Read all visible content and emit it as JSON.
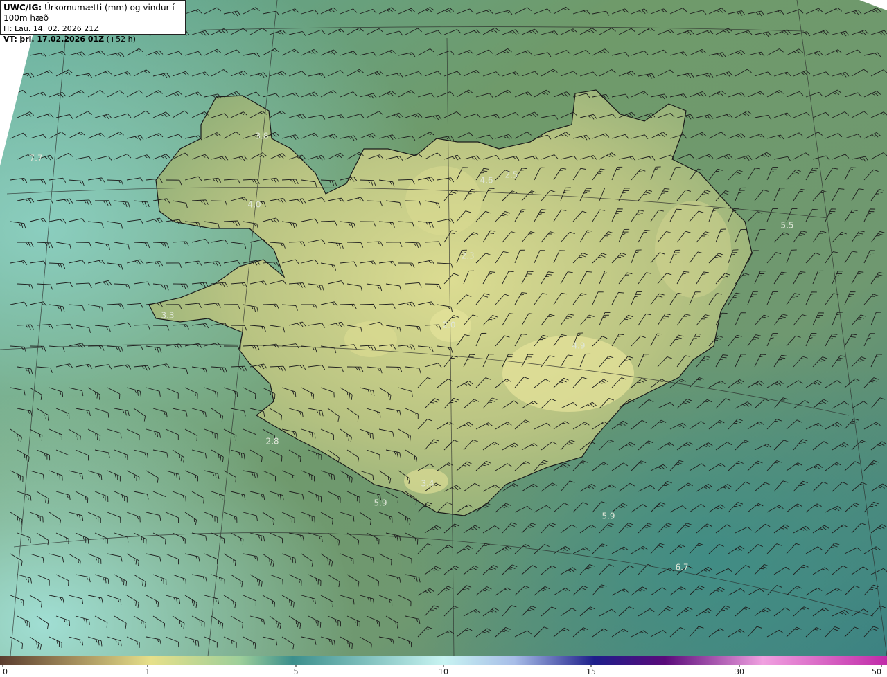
{
  "header": {
    "model": "UWC/IG:",
    "title": "Úrkomumætti (mm) og vindur í 100m hæð",
    "it_label": "IT:",
    "it_value": "Lau. 14. 02. 2026 21Z",
    "vt_label": "VT:",
    "vt_value": "þri. 17.02.2026 01Z",
    "vt_lead": "(+52 h)"
  },
  "map_labels": [
    {
      "text": "3.8"
    },
    {
      "text": "7.7"
    },
    {
      "text": "4.0"
    },
    {
      "text": "4.6"
    },
    {
      "text": "2.5"
    },
    {
      "text": "5.5"
    },
    {
      "text": "2.3"
    },
    {
      "text": "3.3"
    },
    {
      "text": "2.8"
    },
    {
      "text": "3.4"
    },
    {
      "text": "5.9"
    },
    {
      "text": "5.9"
    },
    {
      "text": "6.7"
    },
    {
      "text": "2.0"
    },
    {
      "text": "4.9"
    }
  ],
  "colorbar": {
    "ticks": [
      "0",
      "1",
      "5",
      "10",
      "15",
      "30",
      "50"
    ],
    "colors": [
      "#5a3c2e",
      "#a08a5a",
      "#e6e08a",
      "#9ecf9a",
      "#3c8f8c",
      "#c8f4f2",
      "#a7bde8",
      "#1e1e8a",
      "#5a0a7a",
      "#f0a0e0",
      "#c02aa8"
    ]
  },
  "palette": {
    "ocean_dark": "#3f7c72",
    "ocean_light": "#7fc3b8",
    "land_mid": "#a9b978",
    "land_high": "#dcdc92",
    "coast": "#1a1a1a"
  }
}
